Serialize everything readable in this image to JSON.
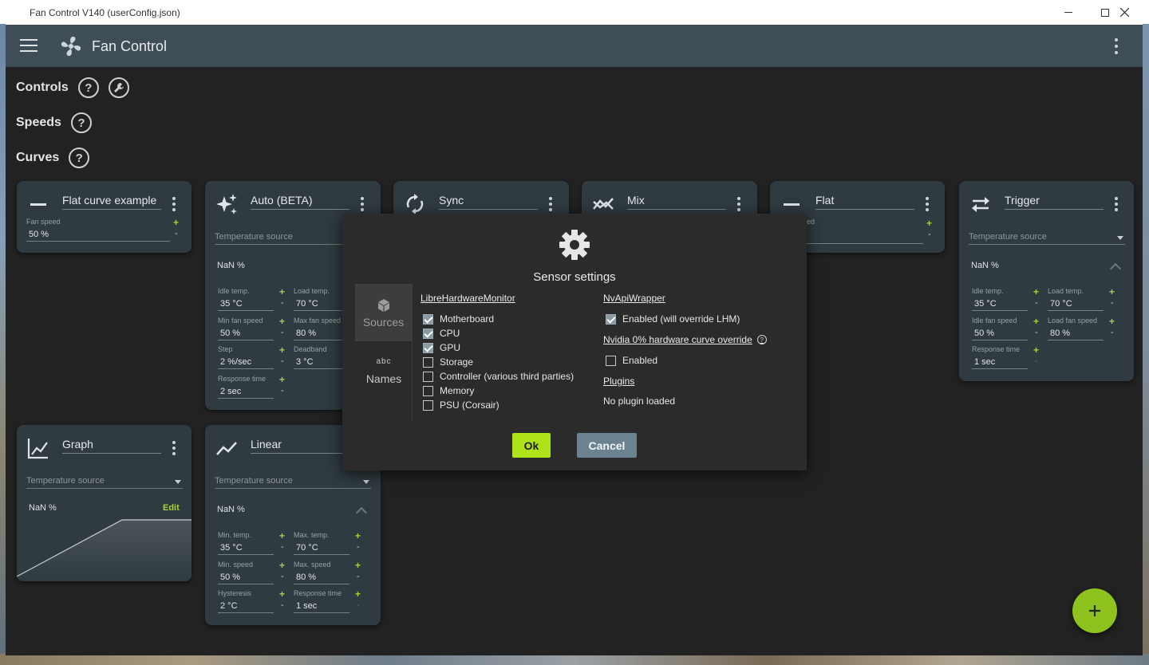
{
  "window": {
    "title": "Fan Control V140 (userConfig.json)"
  },
  "app": {
    "title": "Fan Control"
  },
  "sections": {
    "controls": "Controls",
    "speeds": "Speeds",
    "curves": "Curves",
    "help": "?"
  },
  "cards": {
    "flat_example": {
      "name": "Flat curve example",
      "fan_speed_label": "Fan speed",
      "fan_speed_value": "50 %"
    },
    "auto": {
      "name": "Auto (BETA)",
      "source": "Temperature source",
      "nan": "NaN %",
      "idle_temp_label": "Idle temp.",
      "idle_temp": "35 °C",
      "load_temp_label": "Load temp.",
      "load_temp": "70 °C",
      "min_fan_label": "Min fan speed",
      "min_fan": "50 %",
      "max_fan_label": "Max fan speed",
      "max_fan": "80 %",
      "step_label": "Step",
      "step": "2 %/sec",
      "deadband_label": "Deadband",
      "deadband": "3 °C",
      "response_label": "Response time",
      "response": "2 sec"
    },
    "sync": {
      "name": "Sync"
    },
    "mix": {
      "name": "Mix"
    },
    "flat": {
      "name": "Flat",
      "fan_speed_label_partial": "ed"
    },
    "trigger": {
      "name": "Trigger",
      "source": "Temperature source",
      "nan": "NaN %",
      "idle_temp_label": "Idle temp.",
      "idle_temp": "35 °C",
      "load_temp_label": "Load temp.",
      "load_temp": "70 °C",
      "idle_fan_label": "Idle fan speed",
      "idle_fan": "50 %",
      "load_fan_label": "Load fan speed",
      "load_fan": "80 %",
      "response_label": "Response time",
      "response": "1 sec"
    },
    "graph": {
      "name": "Graph",
      "source": "Temperature source",
      "nan": "NaN %",
      "edit": "Edit"
    },
    "linear": {
      "name": "Linear",
      "source": "Temperature source",
      "nan": "NaN %",
      "min_temp_label": "Min. temp.",
      "min_temp": "35 °C",
      "max_temp_label": "Max. temp.",
      "max_temp": "70 °C",
      "min_speed_label": "Min. speed",
      "min_speed": "50 %",
      "max_speed_label": "Max. speed",
      "max_speed": "80 %",
      "hyst_label": "Hysteresis",
      "hyst": "2 °C",
      "response_label": "Response time",
      "response": "1 sec"
    }
  },
  "dialog": {
    "title": "Sensor settings",
    "nav": {
      "sources": "Sources",
      "names_glyph": "abc",
      "names": "Names"
    },
    "lhm": {
      "header": "LibreHardwareMonitor",
      "items": [
        {
          "label": "Motherboard",
          "checked": true
        },
        {
          "label": "CPU",
          "checked": true
        },
        {
          "label": "GPU",
          "checked": true
        },
        {
          "label": "Storage",
          "checked": false
        },
        {
          "label": "Controller (various third parties)",
          "checked": false
        },
        {
          "label": "Memory",
          "checked": false
        },
        {
          "label": "PSU (Corsair)",
          "checked": false
        }
      ]
    },
    "nvapi": {
      "header": "NvApiWrapper",
      "enabled_label": "Enabled (will override LHM)",
      "enabled": true
    },
    "nvidia0": {
      "header": "Nvidia 0% hardware curve override",
      "enabled_label": "Enabled",
      "enabled": false,
      "help": "?"
    },
    "plugins": {
      "header": "Plugins",
      "status": "No plugin loaded"
    },
    "ok": "Ok",
    "cancel": "Cancel"
  },
  "fab": {
    "symbol": "+"
  },
  "symbols": {
    "plus": "+",
    "minus": "-"
  },
  "colors": {
    "accent": "#a8d23a",
    "appbar": "#3e4d56",
    "card": "#2f3b41",
    "ok": "#aee31a",
    "cancel": "#6b8290"
  }
}
